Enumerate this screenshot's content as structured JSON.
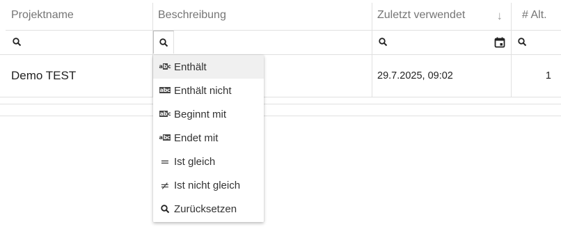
{
  "table": {
    "columns": {
      "name": "Projektname",
      "description": "Beschreibung",
      "last_used": "Zuletzt verwendet",
      "alt_count": "# Alt."
    },
    "sort_indicator": "↓",
    "rows": [
      {
        "name": "Demo TEST",
        "description": "",
        "last_used": "29.7.2025, 09:02",
        "alt_count": "1"
      }
    ]
  },
  "filter_menu": {
    "items": [
      {
        "label": "Enthält",
        "icon": "contains-icon",
        "active": true
      },
      {
        "label": "Enthält nicht",
        "icon": "not-contains-icon"
      },
      {
        "label": "Beginnt mit",
        "icon": "starts-with-icon"
      },
      {
        "label": "Endet mit",
        "icon": "ends-with-icon"
      },
      {
        "label": "Ist gleich",
        "icon": "equals-icon"
      },
      {
        "label": "Ist nicht gleich",
        "icon": "not-equals-icon"
      },
      {
        "label": "Zurücksetzen",
        "icon": "search-icon"
      }
    ]
  },
  "colors": {
    "header_text": "#757575",
    "border": "#e0e0e0",
    "active_item_bg": "#f0f0f0"
  }
}
